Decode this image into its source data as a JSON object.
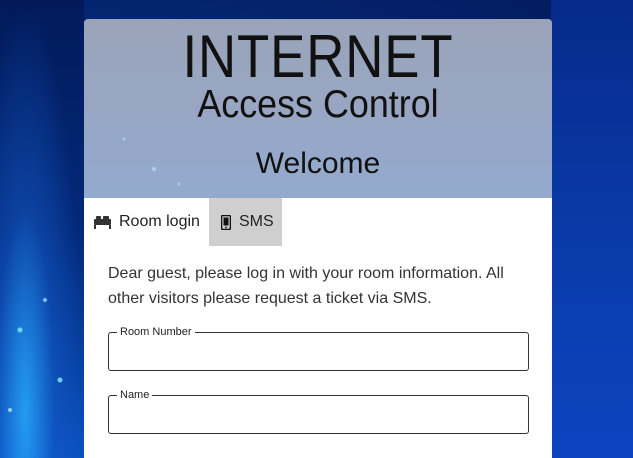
{
  "header": {
    "logo_line1": "INTERNET",
    "logo_line2": "Access Control",
    "welcome": "Welcome"
  },
  "tabs": [
    {
      "label": "Room login",
      "icon": "bed-icon",
      "active": true
    },
    {
      "label": "SMS",
      "icon": "mobile-phone-icon",
      "active": false
    }
  ],
  "intro_text": "Dear guest, please log in with your room information. All other visitors please request a ticket via SMS.",
  "form": {
    "room_number_label": "Room Number",
    "room_number_value": "",
    "name_label": "Name",
    "name_value": ""
  },
  "colors": {
    "header_bg": "#97a7c6",
    "sms_tab_bg": "#cfcfcf",
    "page_bg": "#062a7a"
  }
}
